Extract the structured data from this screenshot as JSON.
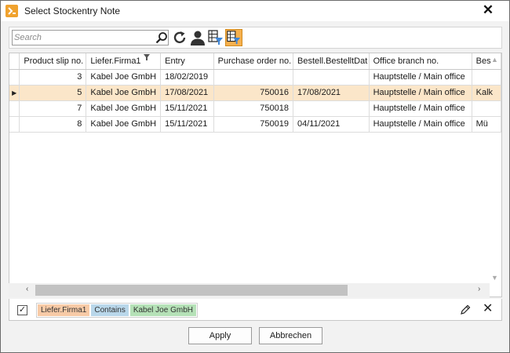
{
  "window": {
    "title": "Select Stockentry Note",
    "close_glyph": "✕",
    "app_icon": "app-logo-icon"
  },
  "toolbar": {
    "search_placeholder": "Search",
    "search_value": "",
    "icons": [
      "search-icon",
      "refresh-icon",
      "user-icon",
      "grid-filter-icon",
      "grid-filter-active-icon"
    ]
  },
  "table": {
    "columns": [
      "",
      "Product slip no.",
      "Liefer.Firma1",
      "Entry",
      "Purchase order no.",
      "Bestell.BestelltDat",
      "Office branch no.",
      "Bes"
    ],
    "rows": [
      {
        "indicator": "",
        "slip": "3",
        "firma": "Kabel Joe GmbH",
        "entry": "18/02/2019",
        "order": "",
        "bestellt": "",
        "office": "Hauptstelle / Main office",
        "bes": ""
      },
      {
        "indicator": "▶",
        "slip": "5",
        "firma": "Kabel Joe GmbH",
        "entry": "17/08/2021",
        "order": "750016",
        "bestellt": "17/08/2021",
        "office": "Hauptstelle / Main office",
        "bes": "Kalk"
      },
      {
        "indicator": "",
        "slip": "7",
        "firma": "Kabel Joe GmbH",
        "entry": "15/11/2021",
        "order": "750018",
        "bestellt": "",
        "office": "Hauptstelle / Main office",
        "bes": ""
      },
      {
        "indicator": "",
        "slip": "8",
        "firma": "Kabel Joe GmbH",
        "entry": "15/11/2021",
        "order": "750019",
        "bestellt": "04/11/2021",
        "office": "Hauptstelle / Main office",
        "bes": "Mü"
      }
    ],
    "selected_row_index": 1
  },
  "filter": {
    "enabled_glyph": "✓",
    "field": "Liefer.Firma1",
    "operator": "Contains",
    "value": "Kabel Joe GmbH"
  },
  "buttons": {
    "apply": "Apply",
    "cancel": "Abbrechen"
  },
  "colors": {
    "accent": "#f6b04d",
    "selected_row": "#fbe6c9"
  }
}
